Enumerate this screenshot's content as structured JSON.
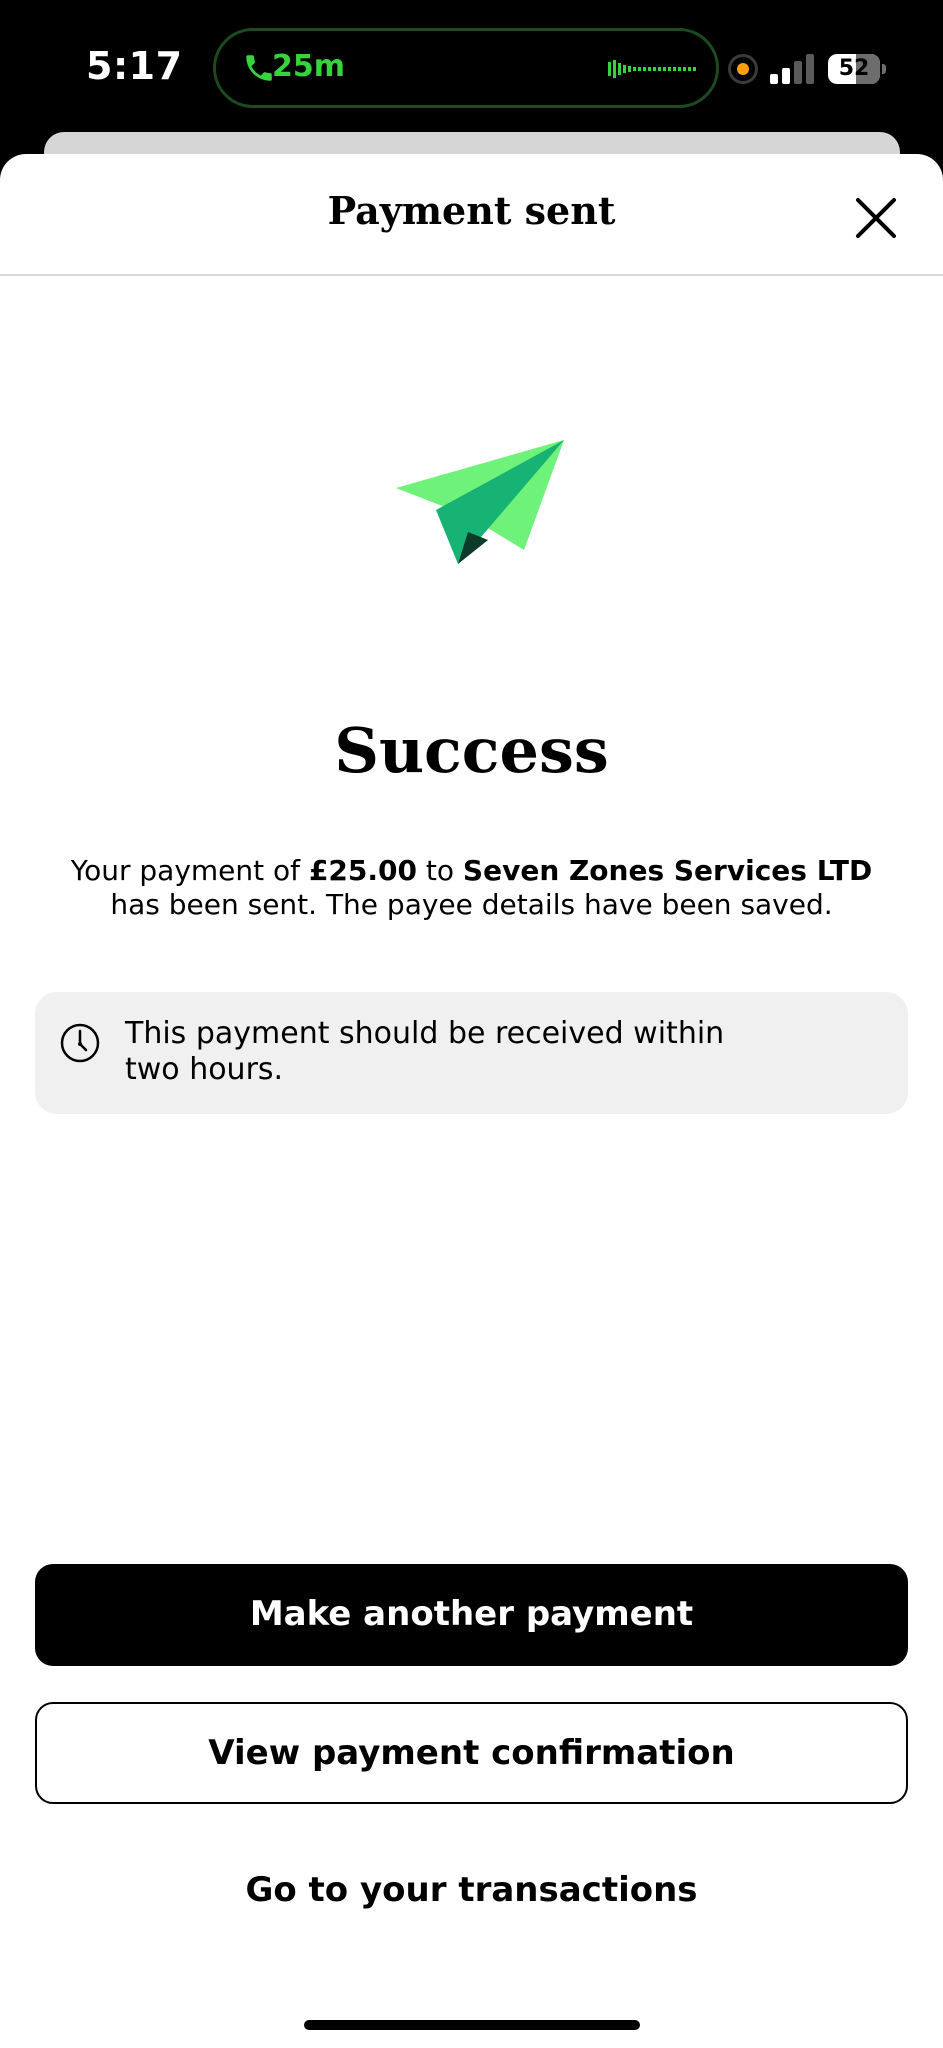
{
  "status_bar": {
    "time": "5:17",
    "call_duration": "25m",
    "battery_level": "52",
    "battery_fraction": 0.52,
    "signal_bars_active": 2,
    "signal_bars_total": 4,
    "call_color": "#35d43d",
    "indicator_color": "#ff9f0a",
    "icons": [
      "phone-icon",
      "audio-waveform-icon",
      "orange-privacy-dot-icon",
      "cellular-signal-icon",
      "battery-icon"
    ]
  },
  "sheet": {
    "title": "Payment sent",
    "close_icon": "close-icon"
  },
  "illustration": {
    "icon": "paper-plane-icon",
    "colors": [
      "#6ef27a",
      "#17b374",
      "#0c3b2b"
    ]
  },
  "success": {
    "heading": "Success",
    "message_prefix": "Your payment of ",
    "amount": "£25.00",
    "message_middle": " to ",
    "payee": "Seven Zones Services LTD",
    "message_suffix": " has been sent. The payee details have been saved."
  },
  "info_card": {
    "icon": "clock-icon",
    "text": "This payment should be received within two hours."
  },
  "actions": {
    "primary_label": "Make another payment",
    "secondary_label": "View payment confirmation",
    "link_label": "Go to your transactions"
  }
}
